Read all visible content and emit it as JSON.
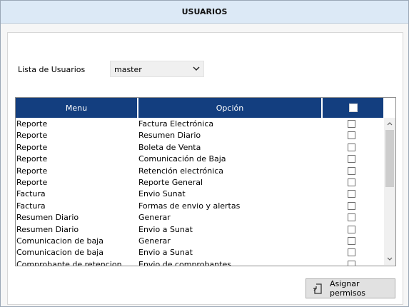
{
  "window": {
    "title": "USUARIOS"
  },
  "user_select": {
    "label": "Lista de Usuarios",
    "value": "master"
  },
  "grid": {
    "columns": [
      "Menu",
      "Opción"
    ],
    "rows": [
      {
        "menu": "Reporte",
        "opcion": "Factura Electrónica",
        "checked": false
      },
      {
        "menu": "Reporte",
        "opcion": "Resumen Diario",
        "checked": false
      },
      {
        "menu": "Reporte",
        "opcion": "Boleta de Venta",
        "checked": false
      },
      {
        "menu": "Reporte",
        "opcion": "Comunicación de Baja",
        "checked": false
      },
      {
        "menu": "Reporte",
        "opcion": "Retención electrónica",
        "checked": false
      },
      {
        "menu": "Reporte",
        "opcion": "Reporte General",
        "checked": false
      },
      {
        "menu": "Factura",
        "opcion": "Envio Sunat",
        "checked": false
      },
      {
        "menu": "Factura",
        "opcion": "Formas de envio y alertas",
        "checked": false
      },
      {
        "menu": "Resumen Diario",
        "opcion": "Generar",
        "checked": false
      },
      {
        "menu": "Resumen Diario",
        "opcion": "Envio a Sunat",
        "checked": false
      },
      {
        "menu": "Comunicacion de baja",
        "opcion": "Generar",
        "checked": false
      },
      {
        "menu": "Comunicacion de baja",
        "opcion": "Envio a Sunat",
        "checked": false
      },
      {
        "menu": "Comprobante de retencion",
        "opcion": "Envio de comprobantes",
        "checked": false
      }
    ]
  },
  "actions": {
    "assign_label": "Asignar permisos"
  },
  "colors": {
    "header": "#133e7f",
    "titlebar": "#dce9f6"
  }
}
